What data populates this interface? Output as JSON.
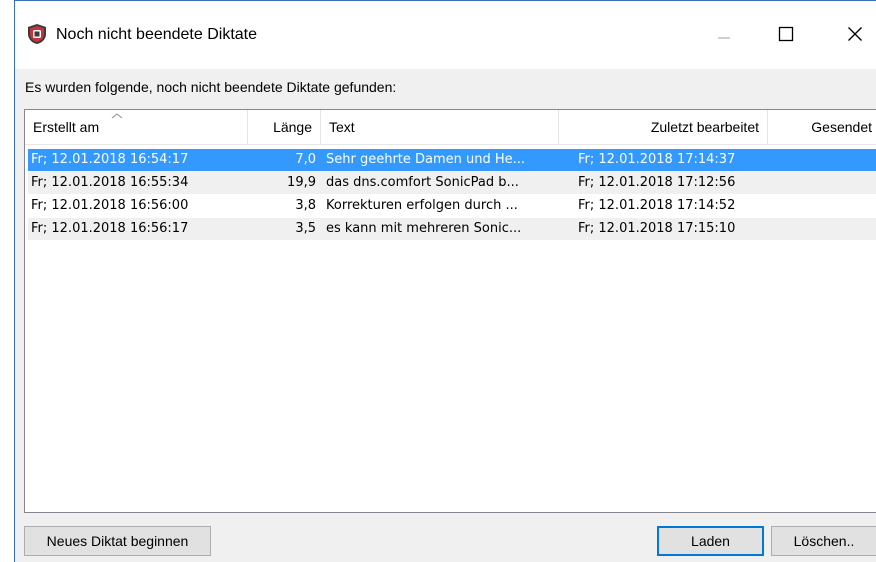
{
  "window": {
    "title": "Noch nicht beendete Diktate",
    "icon": "shield-icon",
    "controls": {
      "minimize": "minimize-icon",
      "maximize": "maximize-icon",
      "close": "close-icon"
    }
  },
  "prompt": "Es wurden folgende, noch nicht beendete Diktate gefunden:",
  "table": {
    "columns": [
      "Erstellt am",
      "Länge",
      "Text",
      "Zuletzt bearbeitet",
      "Gesendet"
    ],
    "sort_column": "Erstellt am",
    "rows": [
      {
        "erstellt": "Fr; 12.01.2018 16:54:17",
        "laenge": "7,0",
        "text": "Sehr geehrte Damen und He...",
        "zuletzt": "Fr; 12.01.2018 17:14:37",
        "gesendet": "",
        "selected": true
      },
      {
        "erstellt": "Fr; 12.01.2018 16:55:34",
        "laenge": "19,9",
        "text": " das dns.comfort SonicPad b...",
        "zuletzt": "Fr; 12.01.2018 17:12:56",
        "gesendet": ""
      },
      {
        "erstellt": "Fr; 12.01.2018 16:56:00",
        "laenge": "3,8",
        "text": " Korrekturen erfolgen durch ...",
        "zuletzt": "Fr; 12.01.2018 17:14:52",
        "gesendet": ""
      },
      {
        "erstellt": "Fr; 12.01.2018 16:56:17",
        "laenge": "3,5",
        "text": " es kann mit mehreren Sonic...",
        "zuletzt": "Fr; 12.01.2018 17:15:10",
        "gesendet": ""
      }
    ]
  },
  "buttons": {
    "new": "Neues Diktat beginnen",
    "load": "Laden",
    "delete": "Löschen.."
  },
  "colors": {
    "selection": "#3399ff",
    "default_button_border": "#0078d7",
    "icon_red": "#c8323c"
  }
}
